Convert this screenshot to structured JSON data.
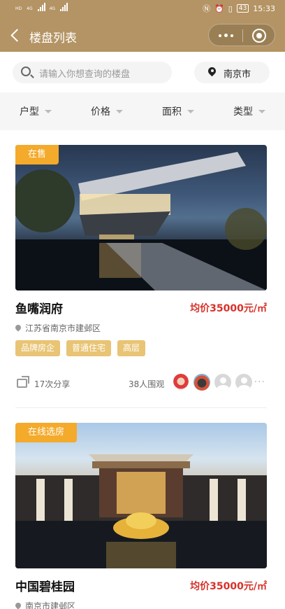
{
  "status": {
    "left": [
      "HD",
      "4G",
      "4G"
    ],
    "battery": "43",
    "time": "15:33"
  },
  "nav": {
    "title": "楼盘列表"
  },
  "search": {
    "placeholder": "请输入你想查询的楼盘",
    "city": "南京市"
  },
  "filters": [
    "户型",
    "价格",
    "面积",
    "类型"
  ],
  "listings": [
    {
      "badge": "在售",
      "name": "鱼嘴润府",
      "price": "均价35000元/㎡",
      "address": "江苏省南京市建邺区",
      "tags": [
        "品牌房企",
        "普通住宅",
        "高层"
      ],
      "shares": "17次分享",
      "views": "38人围观"
    },
    {
      "badge": "在线选房",
      "name": "中国碧桂园",
      "price": "均价35000元/㎡",
      "address": "南京市建邺区"
    }
  ]
}
